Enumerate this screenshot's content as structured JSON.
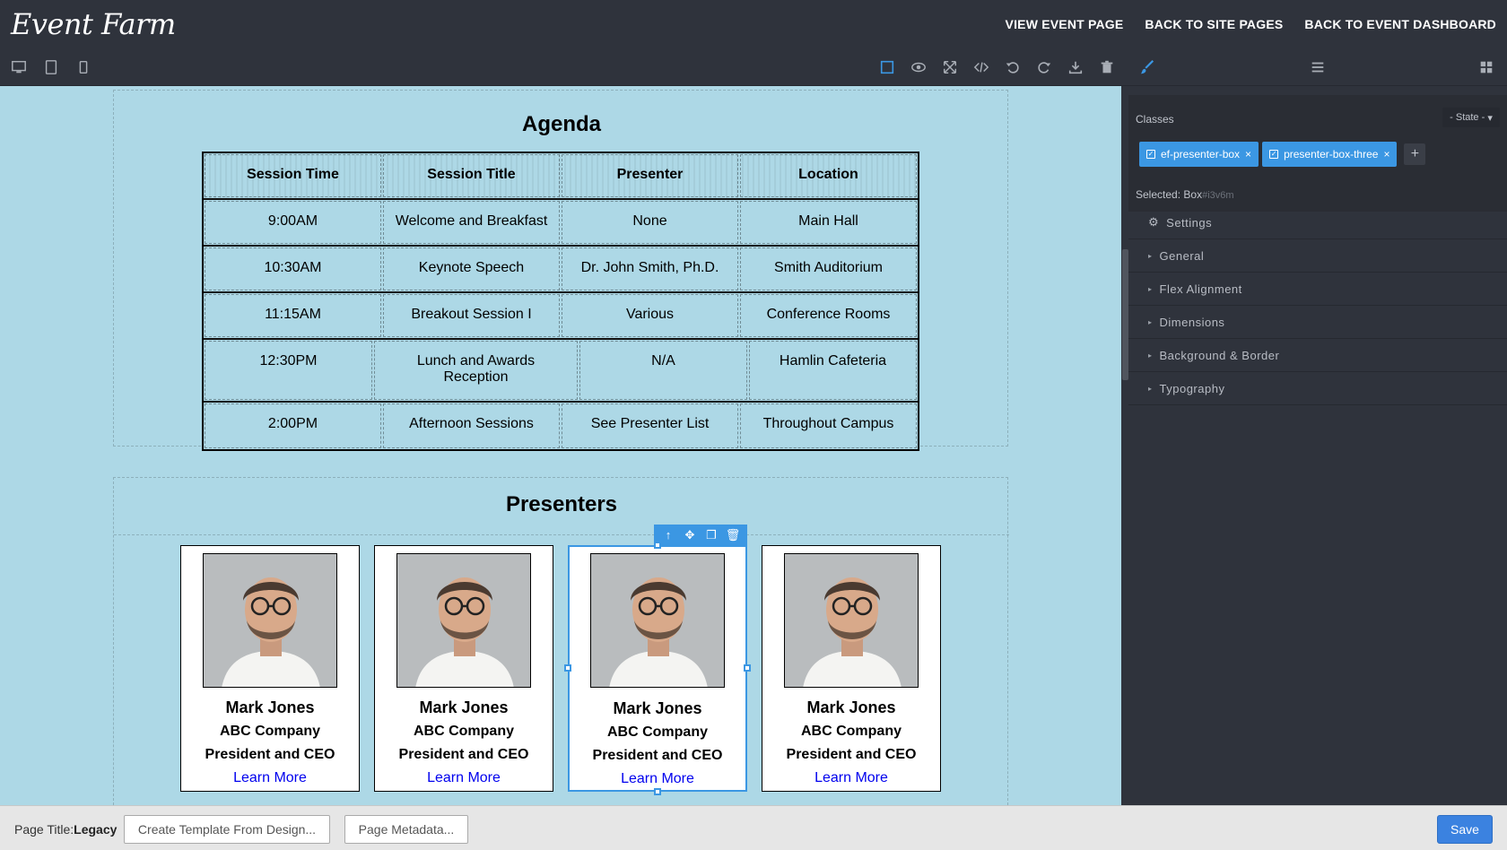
{
  "app": {
    "logo": "Event Farm"
  },
  "header": {
    "links": [
      "VIEW EVENT PAGE",
      "BACK TO SITE PAGES",
      "BACK TO EVENT DASHBOARD"
    ]
  },
  "toolbar": {
    "devices": [
      "desktop-icon",
      "tablet-icon",
      "mobile-icon"
    ],
    "tools": [
      "outline-icon",
      "preview-eye-icon",
      "fullscreen-icon",
      "code-icon",
      "undo-icon",
      "redo-icon",
      "download-icon",
      "trash-icon"
    ],
    "panel_tabs": [
      "paint-brush-icon",
      "layers-icon",
      "blocks-icon"
    ]
  },
  "agenda": {
    "title": "Agenda",
    "headers": [
      "Session Time",
      "Session Title",
      "Presenter",
      "Location"
    ],
    "rows": [
      [
        "9:00AM",
        "Welcome and Breakfast",
        "None",
        "Main Hall"
      ],
      [
        "10:30AM",
        "Keynote Speech",
        "Dr. John Smith, Ph.D.",
        "Smith Auditorium"
      ],
      [
        "11:15AM",
        "Breakout Session I",
        "Various",
        "Conference Rooms"
      ],
      [
        "12:30PM",
        "Lunch and Awards Reception",
        "N/A",
        "Hamlin Cafeteria"
      ],
      [
        "2:00PM",
        "Afternoon Sessions",
        "See Presenter List",
        "Throughout Campus"
      ]
    ]
  },
  "presenters": {
    "title": "Presenters",
    "cards": [
      {
        "name": "Mark Jones",
        "company": "ABC Company",
        "role": "President and CEO",
        "link": "Learn More"
      },
      {
        "name": "Mark Jones",
        "company": "ABC Company",
        "role": "President and CEO",
        "link": "Learn More"
      },
      {
        "name": "Mark Jones",
        "company": "ABC Company",
        "role": "President and CEO",
        "link": "Learn More"
      },
      {
        "name": "Mark Jones",
        "company": "ABC Company",
        "role": "President and CEO",
        "link": "Learn More"
      }
    ]
  },
  "panel": {
    "classes_label": "Classes",
    "state": "- State -",
    "tags": [
      "ef-presenter-box",
      "presenter-box-three"
    ],
    "add": "+",
    "selected_label": "Selected:",
    "selected_value": "Box",
    "selected_id": "#i3v6m",
    "sections": [
      "Settings",
      "General",
      "Flex Alignment",
      "Dimensions",
      "Background & Border",
      "Typography"
    ]
  },
  "footer": {
    "page_title_label": "Page Title:",
    "page_title": "Legacy",
    "template_btn": "Create Template From Design...",
    "metadata_btn": "Page Metadata...",
    "save": "Save"
  },
  "colors": {
    "dark": "#2f333c",
    "canvas_bg": "#add8e6",
    "accent": "#3b97e3",
    "link": "#0000ee"
  }
}
